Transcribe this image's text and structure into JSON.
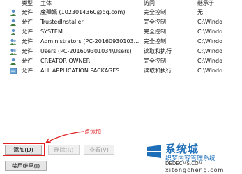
{
  "header": {
    "type": "类型",
    "principal": "主体",
    "access": "访问",
    "inherit": "继承于"
  },
  "entries": [
    {
      "type": "允许",
      "principal": "魔殚嫣 (1023014360@qq.com)",
      "access": "完全控制",
      "inherit": "无"
    },
    {
      "type": "允许",
      "principal": "TrustedInstaller",
      "access": "完全控制",
      "inherit": "C:\\Windo"
    },
    {
      "type": "允许",
      "principal": "SYSTEM",
      "access": "完全控制",
      "inherit": "C:\\Windo"
    },
    {
      "type": "允许",
      "principal": "Administrators (PC-20160930103...",
      "access": "完全控制",
      "inherit": "C:\\Windo"
    },
    {
      "type": "允许",
      "principal": "Users (PC-201609301034\\Users)",
      "access": "读取和执行",
      "inherit": "C:\\Windo"
    },
    {
      "type": "允许",
      "principal": "CREATOR OWNER",
      "access": "完全控制",
      "inherit": "C:\\Windo"
    },
    {
      "type": "允许",
      "principal": "ALL APPLICATION PACKAGES",
      "access": "读取和执行",
      "inherit": "C:\\Windo"
    }
  ],
  "buttons": {
    "add": "添加(D)",
    "remove": "删除(R)",
    "view": "查看(V)",
    "disable_inherit": "禁用继承(I)"
  },
  "annotation": {
    "hint": "点添加"
  },
  "watermark": {
    "title": "系统城",
    "line1": "织梦内容管理系统",
    "line2": "DEDECMS.COM",
    "line3": "xitongcheng.com"
  },
  "colors": {
    "annotation": "#e02020",
    "watermark": "#1e6fb8"
  }
}
